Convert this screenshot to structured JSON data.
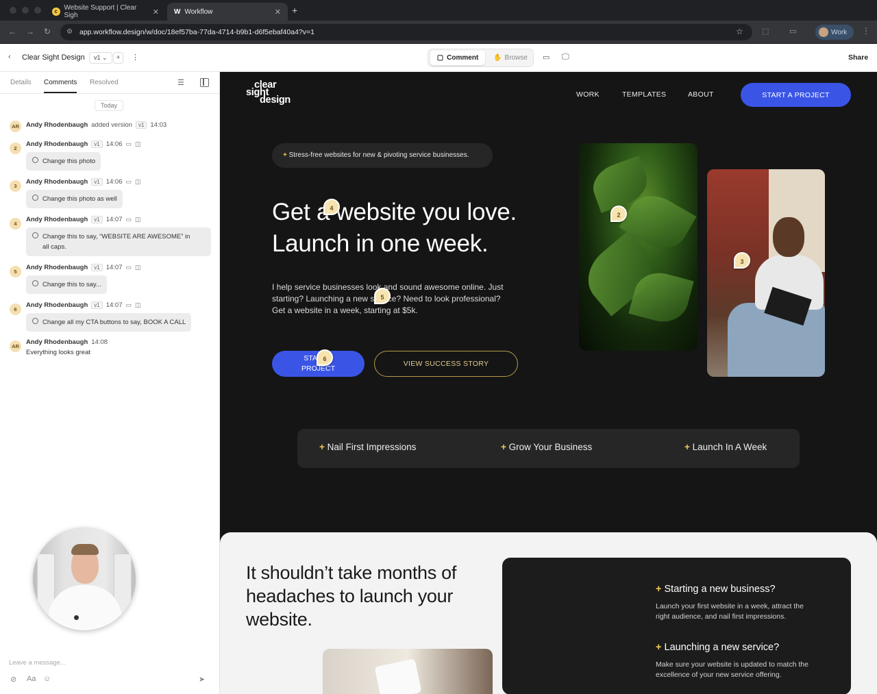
{
  "browser": {
    "tabs": [
      {
        "title": "Website Support | Clear Sigh",
        "favicon": "clearsight-favicon"
      },
      {
        "title": "Workflow",
        "favicon": "W"
      }
    ],
    "url": "app.workflow.design/w/doc/18ef57ba-77da-4714-b9b1-d6f5ebaf40a4?v=1",
    "profile_label": "Work"
  },
  "app": {
    "project_name": "Clear Sight Design",
    "version_label": "v1",
    "mode_comment": "Comment",
    "mode_browse": "Browse",
    "share_label": "Share"
  },
  "sidebar": {
    "tabs": [
      "Details",
      "Comments",
      "Resolved"
    ],
    "active_tab": "Comments",
    "date_divider": "Today",
    "entries": [
      {
        "avatar": "AR",
        "author": "Andy Rhodenbaugh",
        "action": "added version",
        "version": "v1",
        "time": "14:03"
      },
      {
        "avatar": "2",
        "author": "Andy Rhodenbaugh",
        "version": "v1",
        "time": "14:06",
        "text": "Change this photo"
      },
      {
        "avatar": "3",
        "author": "Andy Rhodenbaugh",
        "version": "v1",
        "time": "14:06",
        "text": "Change this photo as well"
      },
      {
        "avatar": "4",
        "author": "Andy Rhodenbaugh",
        "version": "v1",
        "time": "14:07",
        "text_line1": "Change this to say, “WEBSITE ARE AWESOME” in",
        "text_line2": "all caps."
      },
      {
        "avatar": "5",
        "author": "Andy Rhodenbaugh",
        "version": "v1",
        "time": "14:07",
        "text": "Change this to say..."
      },
      {
        "avatar": "6",
        "author": "Andy Rhodenbaugh",
        "version": "v1",
        "time": "14:07",
        "text": "Change all my CTA buttons to say, BOOK A CALL"
      },
      {
        "avatar": "AR",
        "author": "Andy Rhodenbaugh",
        "time": "14:08",
        "text": "Everything looks great"
      }
    ],
    "message_placeholder": "Leave a message..."
  },
  "site": {
    "logo_lines": [
      "clear",
      "sight",
      "design"
    ],
    "nav": [
      "WORK",
      "TEMPLATES",
      "ABOUT"
    ],
    "nav_cta": "START A PROJECT",
    "tagline": "Stress-free websites for new & pivoting service businesses.",
    "headline_line1": "Get a website you love.",
    "headline_line2": "Launch in one week.",
    "body_line1": "I help service businesses look and sound awesome online. Just",
    "body_line2": "starting? Launching a new service? Need to look professional?",
    "body_line3": "Get a website in a week, starting at $5k.",
    "primary_cta_line1": "START A",
    "primary_cta_line2": "PROJECT",
    "secondary_cta": "VIEW SUCCESS STORY",
    "features": [
      "Nail First Impressions",
      "Grow Your Business",
      "Launch In A Week"
    ],
    "section2_heading": "It shouldn’t take months of headaches to launch your website.",
    "section2_items": [
      {
        "title": "Starting a new business?",
        "line1": "Launch your first website in a week, attract the",
        "line2": "right audience, and nail first impressions."
      },
      {
        "title": "Launching a new service?",
        "line1": "Make sure your website is updated to match the",
        "line2": "excellence of your new service offering."
      }
    ]
  },
  "pins": [
    "2",
    "3",
    "4",
    "5",
    "6"
  ],
  "colors": {
    "accent_blue": "#3a55e6",
    "gold": "#f0c85a",
    "pin_bg": "#f6e3b0"
  }
}
